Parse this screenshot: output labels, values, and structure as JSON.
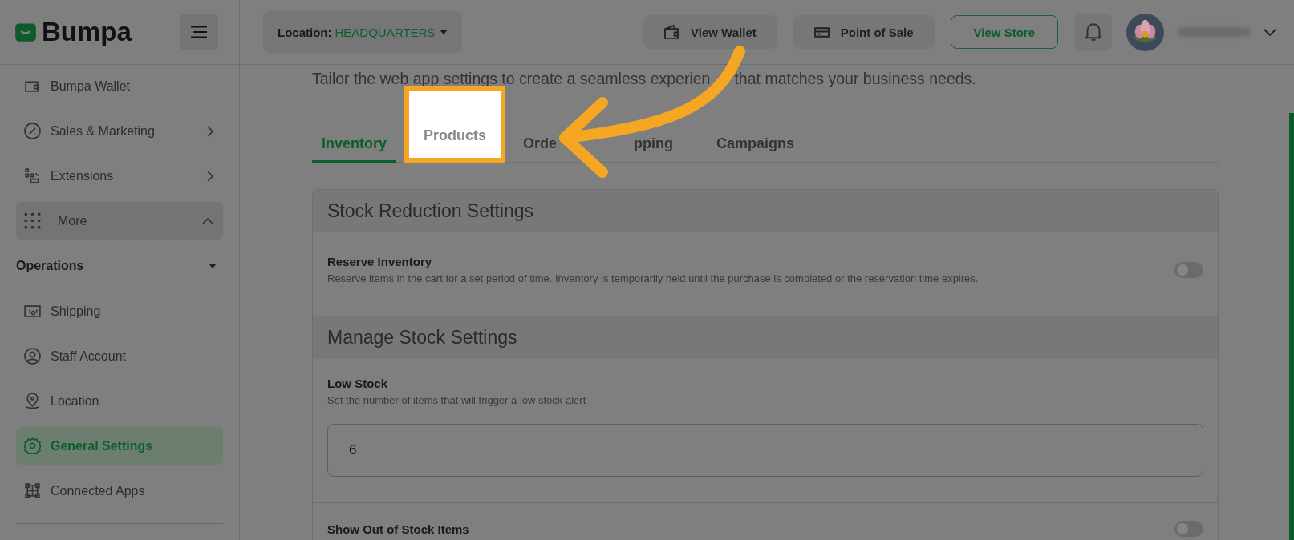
{
  "header": {
    "logo": "Bumpa",
    "location_label": "Location:",
    "location_value": "HEADQUARTERS",
    "buttons": [
      {
        "label": "View Wallet",
        "kind": "soft"
      },
      {
        "label": "Point of Sale",
        "kind": "soft"
      },
      {
        "label": "View Store",
        "kind": "outline"
      }
    ]
  },
  "sidebar": {
    "items": [
      {
        "label": "Bumpa Wallet",
        "kind": "link",
        "selected": false
      },
      {
        "label": "Sales & Marketing",
        "kind": "submenu",
        "selected": false
      },
      {
        "label": "Extensions",
        "kind": "submenu",
        "selected": false
      },
      {
        "label": "More",
        "kind": "more",
        "expanded": true,
        "selected": false
      },
      {
        "label": "Operations",
        "kind": "section",
        "expanded": true
      },
      {
        "label": "Shipping",
        "kind": "link",
        "selected": false
      },
      {
        "label": "Staff Account",
        "kind": "link",
        "selected": false
      },
      {
        "label": "Location",
        "kind": "link",
        "selected": false
      },
      {
        "label": "General Settings",
        "kind": "link",
        "selected": true
      },
      {
        "label": "Connected Apps",
        "kind": "link",
        "selected": false
      }
    ]
  },
  "page": {
    "subtitle_parts": [
      "Tailor the web app settings to create a seamless experien",
      "that matches your business needs."
    ],
    "tabs": [
      {
        "label": "Inventory",
        "selected": true,
        "spotlit": false
      },
      {
        "label": "Products",
        "selected": false,
        "spotlit": true
      },
      {
        "label": "Orde",
        "selected": false,
        "spotlit": false
      },
      {
        "label": "pping",
        "selected": false,
        "spotlit": false
      },
      {
        "label": "Campaigns",
        "selected": false,
        "spotlit": false
      }
    ],
    "sections": [
      {
        "title": "Stock Reduction Settings",
        "settings": [
          {
            "kind": "toggle",
            "label": "Reserve Inventory",
            "description": "Reserve items in the cart for a set period of time. Inventory is temporarily held until the purchase is completed or the reservation time expires.",
            "on": false
          }
        ]
      },
      {
        "title": "Manage Stock Settings",
        "settings": [
          {
            "kind": "number",
            "label": "Low Stock",
            "description": "Set the number of items that will trigger a low stock alert",
            "value": "6"
          }
        ]
      },
      {
        "settings": [
          {
            "kind": "toggle",
            "label": "Show Out of Stock Items",
            "on": false
          }
        ]
      }
    ]
  }
}
